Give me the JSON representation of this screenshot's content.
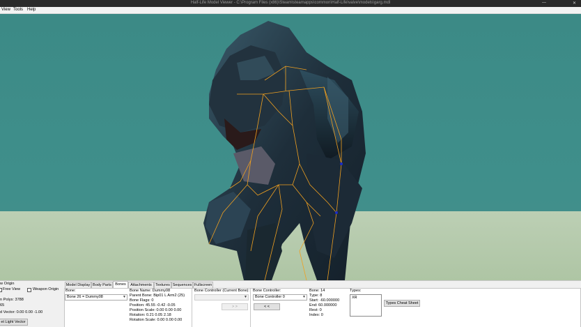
{
  "window": {
    "title": "Half-Life Model Viewer - C:\\Program Files (x86)\\Steam\\steamapps\\common\\Half-Life\\valve\\models\\garg.mdl",
    "minimize": "—",
    "close": "✕"
  },
  "menu": {
    "view": "View",
    "tools": "Tools",
    "help": "Help"
  },
  "left_panel": {
    "show_origin": "w Origin",
    "free_view": "Free View",
    "weapon_origin": "Weapon Origin",
    "polys": "n Polys: 3788",
    "value": "65",
    "light_vector": "d Vector: 0.00 0.00 -1.00",
    "reset_light": "et Light Vector"
  },
  "tabs": {
    "model_display": "Model Display",
    "body_parts": "Body Parts",
    "bones": "Bones",
    "attachments": "Attachments",
    "textures": "Textures",
    "sequences": "Sequences",
    "fullscreen": "Fullscreen"
  },
  "bone_panel": {
    "bone_label": "Bone:",
    "bone_selected": "Bone 26 = Dummy08",
    "name": "Bone Name: Dummy08",
    "parent": "Parent Bone: Bip01 L Arm2 (25)",
    "flags": "Bone Flags: 0",
    "position": "Position: 45.55 -0.42 -0.05",
    "position_scale": "Position Scale: 0.00 0.00 0.00",
    "rotation": "Rotation: 0.21 0.05 2.18",
    "rotation_scale": "Rotation Scale: 0.00 0.00 0.00"
  },
  "controller_current": {
    "label": "Bone Controller (Current Bone):",
    "button": "> >"
  },
  "controller": {
    "label": "Bone Controller:",
    "selected": "Bone Controller 0",
    "button": "< <",
    "bone": "Bone: 14",
    "type": "Type: 8",
    "start": "Start: -60.000000",
    "end": "End: 60.000000",
    "rest": "Rest: 0",
    "index": "Index: 0"
  },
  "types": {
    "label": "Types:",
    "items": [
      "XR"
    ],
    "cheat_sheet": "Types Cheat Sheet"
  },
  "colors": {
    "background": "#3f8f8b",
    "ground": "#b5cbac",
    "bone_line": "#f0a020",
    "bone_joint": "#1a2cc8"
  }
}
